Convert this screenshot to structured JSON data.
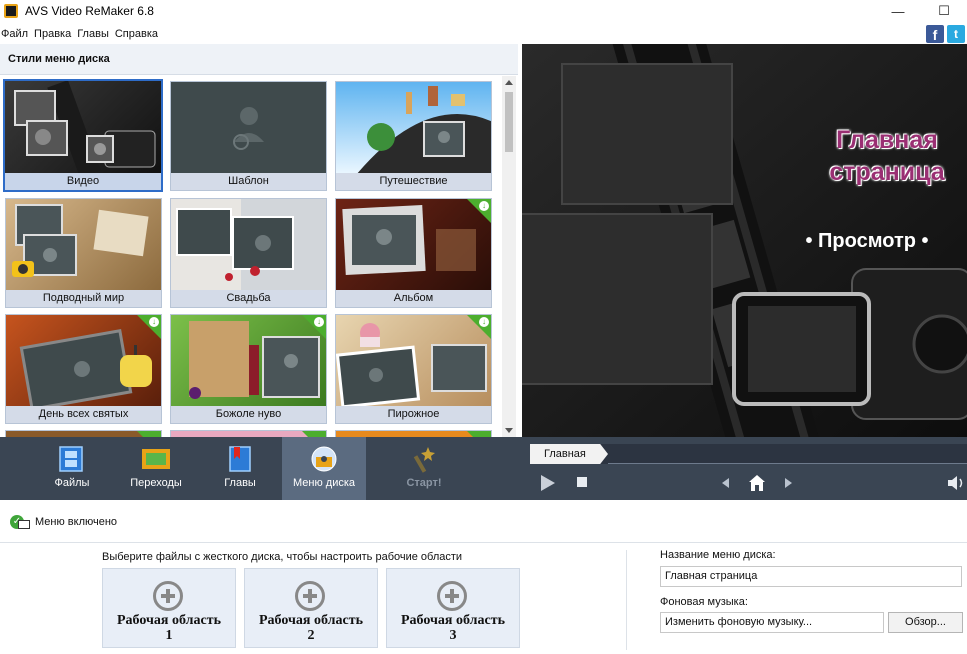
{
  "window": {
    "title": "AVS Video ReMaker 6.8",
    "minimize": "—",
    "maximize": "☐"
  },
  "menu": {
    "file": "Файл",
    "edit": "Правка",
    "chapters": "Главы",
    "help": "Справка"
  },
  "social": {
    "facebook": "f",
    "twitter": "t"
  },
  "styles_panel": {
    "header": "Стили меню диска",
    "items": [
      {
        "label": "Видео",
        "selected": true
      },
      {
        "label": "Шаблон"
      },
      {
        "label": "Путешествие"
      },
      {
        "label": "Подводный мир"
      },
      {
        "label": "Свадьба"
      },
      {
        "label": "Альбом",
        "download": true
      },
      {
        "label": "День всех святых",
        "download": true
      },
      {
        "label": "Божоле нуво",
        "download": true
      },
      {
        "label": "Пирожное",
        "download": true
      }
    ]
  },
  "preview": {
    "title": "Главная страница",
    "view": "• Просмотр •"
  },
  "toolbar": {
    "files": "Файлы",
    "transitions": "Переходы",
    "chapters": "Главы",
    "disc_menu": "Меню диска",
    "start": "Старт!"
  },
  "sequence": {
    "tab": "Главная"
  },
  "bottom": {
    "menu_enabled": "Меню включено",
    "hint": "Выберите файлы с жесткого диска, чтобы настроить рабочие области",
    "workareas": [
      {
        "line1": "Рабочая область",
        "line2": "1"
      },
      {
        "line1": "Рабочая область",
        "line2": "2"
      },
      {
        "line1": "Рабочая область",
        "line2": "3"
      }
    ],
    "menu_name_label": "Название меню диска:",
    "menu_name_value": "Главная страница",
    "music_label": "Фоновая музыка:",
    "music_value": "Изменить фоновую музыку...",
    "browse": "Обзор..."
  },
  "colors": {
    "toolbar_bg": "#3a4553",
    "active_tab": "#5b6b80",
    "selection": "#2e6cc8",
    "title_pink": "#9a2f73"
  }
}
